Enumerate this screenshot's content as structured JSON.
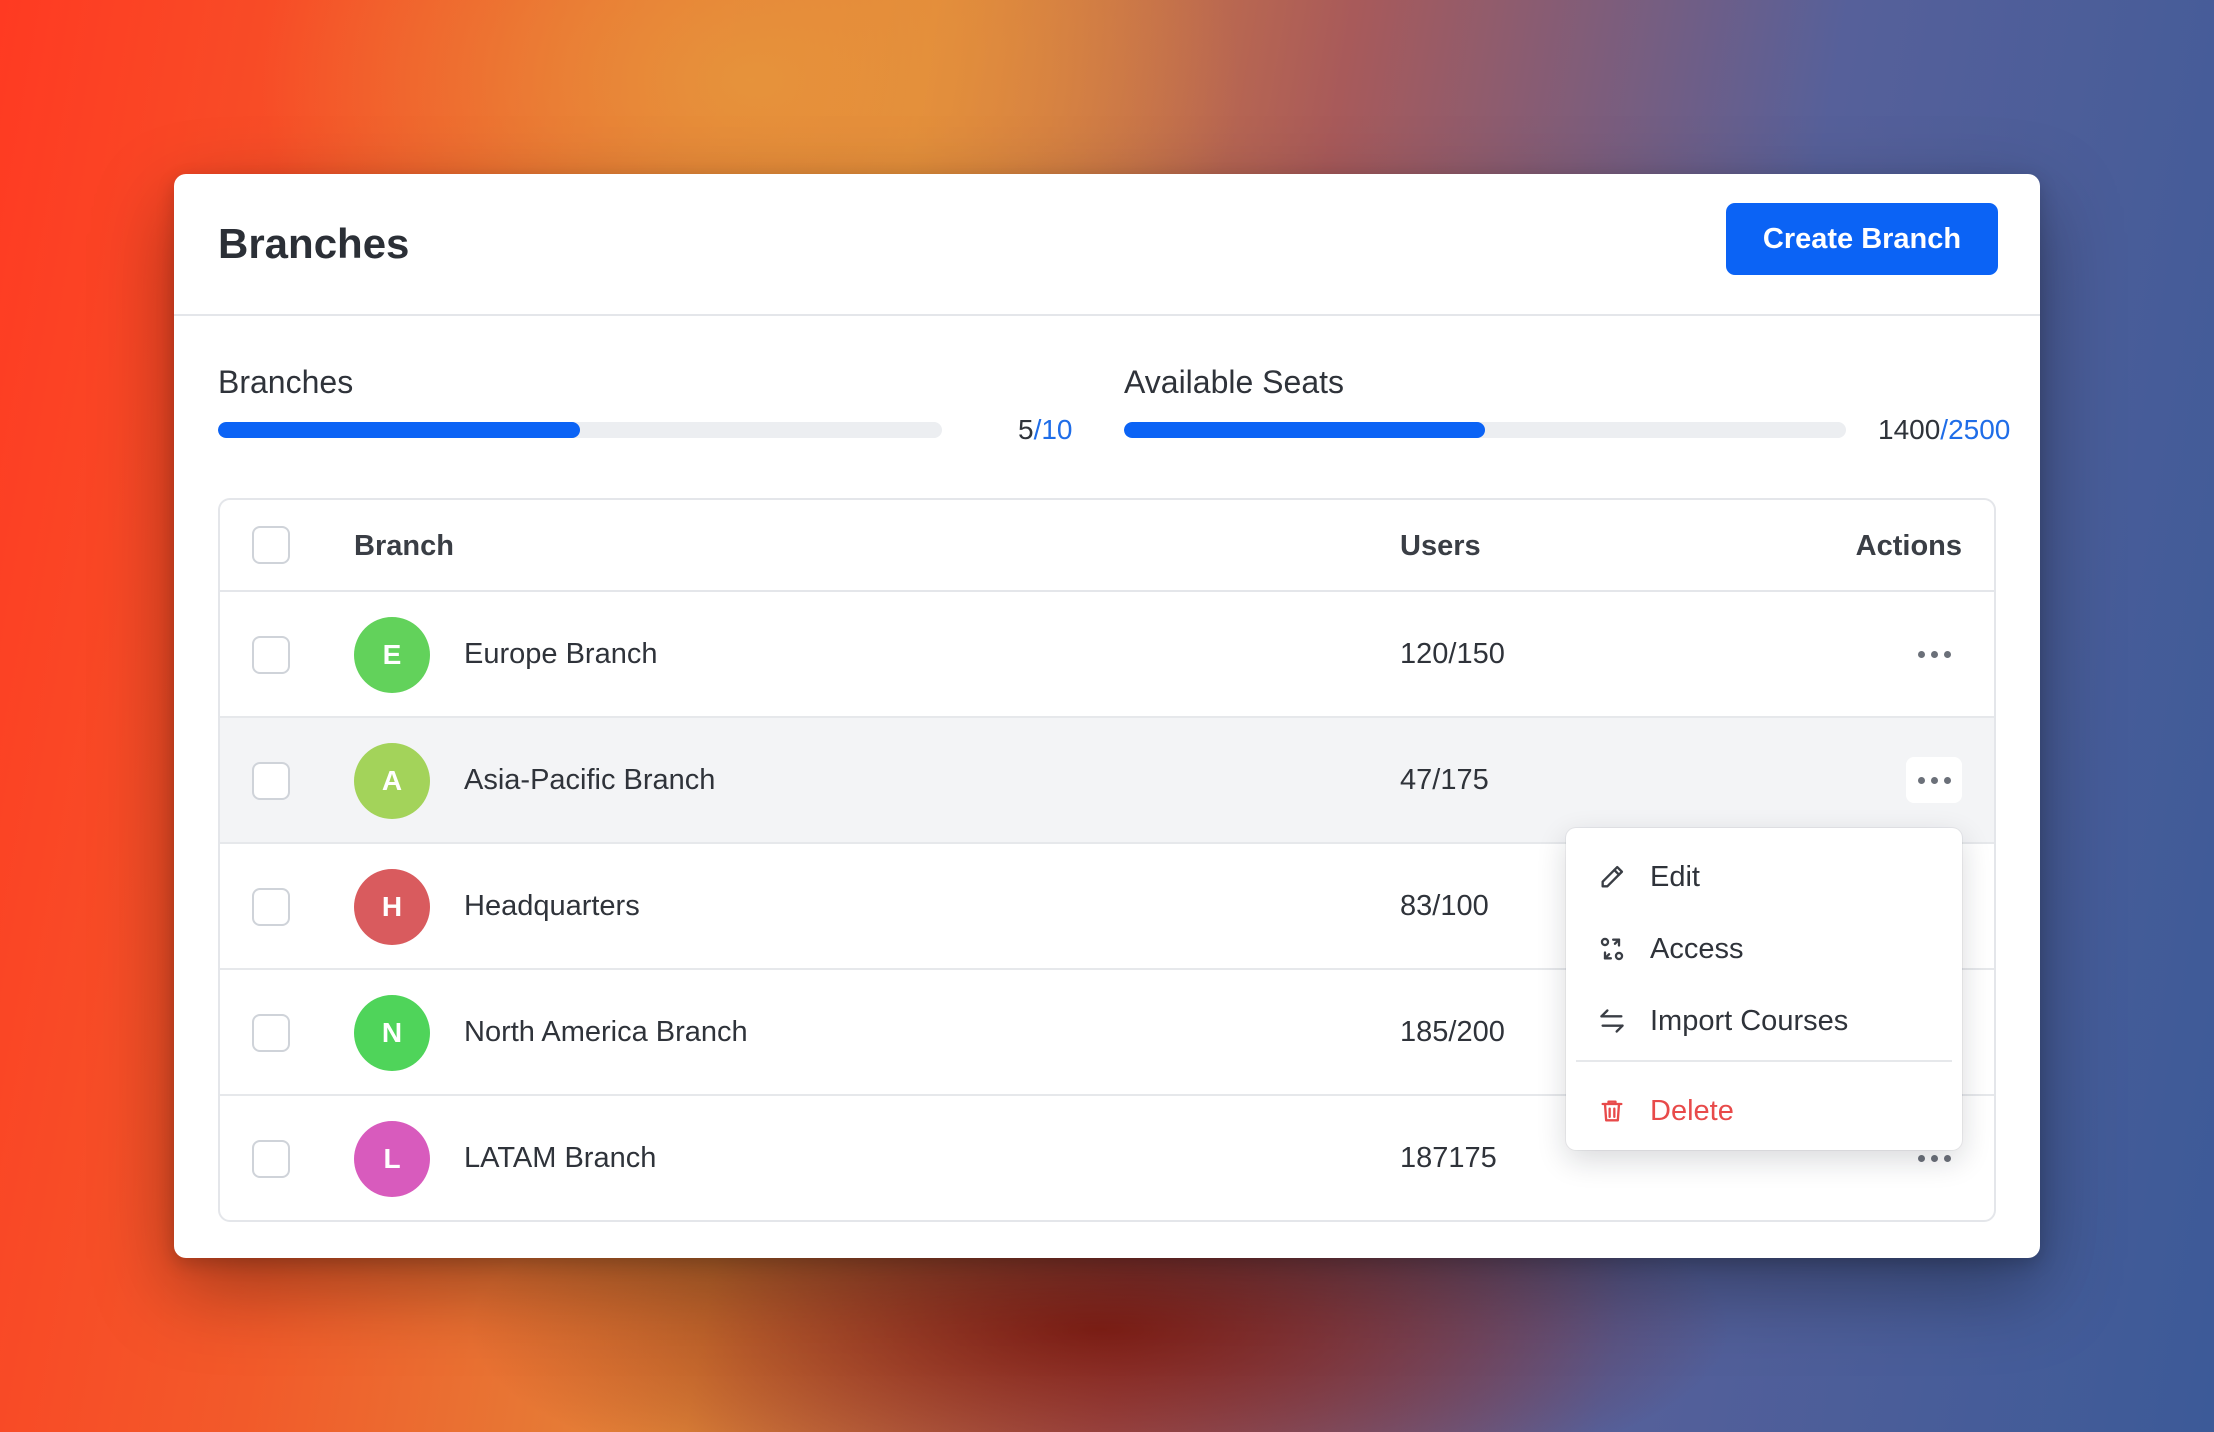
{
  "header": {
    "title": "Branches",
    "create_button_label": "Create Branch"
  },
  "stats": {
    "branches": {
      "label": "Branches",
      "used": "5",
      "separator": "/",
      "total": "10",
      "progress": 0.5
    },
    "seats": {
      "label": "Available Seats",
      "used": "1400",
      "separator": "/",
      "total": "2500",
      "progress": 0.5
    }
  },
  "table": {
    "columns": {
      "branch": "Branch",
      "users": "Users",
      "actions": "Actions"
    },
    "rows": [
      {
        "initial": "E",
        "name": "Europe Branch",
        "users": "120/150",
        "avatar_color": "#62d25b"
      },
      {
        "initial": "A",
        "name": "Asia-Pacific Branch",
        "users": "47/175",
        "avatar_color": "#a3d35a"
      },
      {
        "initial": "H",
        "name": "Headquarters",
        "users": "83/100",
        "avatar_color": "#d95b5e"
      },
      {
        "initial": "N",
        "name": "North America Branch",
        "users": "185/200",
        "avatar_color": "#4fd45a"
      },
      {
        "initial": "L",
        "name": "LATAM Branch",
        "users": "187175",
        "avatar_color": "#d85bbd"
      }
    ]
  },
  "menu": {
    "items": [
      {
        "label": "Edit",
        "icon": "pencil-icon"
      },
      {
        "label": "Access",
        "icon": "access-icon"
      },
      {
        "label": "Import Courses",
        "icon": "import-arrows-icon"
      }
    ],
    "danger_item": {
      "label": "Delete",
      "icon": "trash-icon"
    }
  },
  "colors": {
    "accent": "#0b63f5",
    "danger": "#e84a4a"
  }
}
